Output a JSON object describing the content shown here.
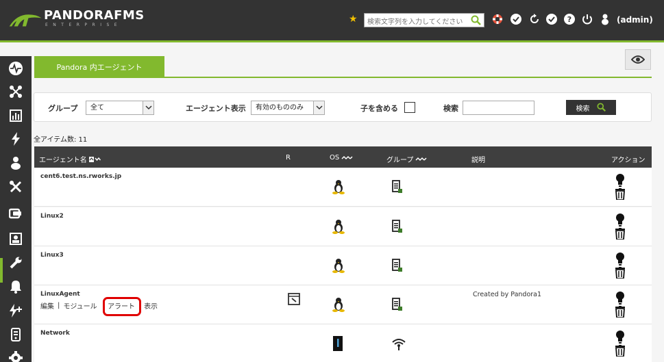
{
  "header": {
    "logo_text": "PANDORAFMS",
    "logo_sub": "ENTERPRISE",
    "search_placeholder": "検索文字列を入力してください",
    "user": "(admin)"
  },
  "colors": {
    "accent": "#82b92e",
    "header_bg": "#333333",
    "highlight": "#e00000"
  },
  "sidebar": {
    "items": [
      "monitoring-icon",
      "topology-icon",
      "reports-icon",
      "events-icon",
      "users-icon",
      "tools-icon",
      "agents-icon",
      "contacts-icon",
      "settings-icon",
      "alerts-icon",
      "extensions-icon",
      "server-icon",
      "gear-icon"
    ]
  },
  "tab": {
    "label": "Pandora 内エージェント"
  },
  "filter": {
    "group_label": "グループ",
    "group_value": "全て",
    "show_label": "エージェント表示",
    "show_value": "有効のもののみ",
    "children_label": "子を含める",
    "search_label": "検索",
    "search_button": "検索"
  },
  "total": "全アイテム数: 11",
  "table": {
    "columns": {
      "name": "エージェント名",
      "r": "R",
      "os": "OS",
      "group": "グループ",
      "desc": "説明",
      "actions": "アクション"
    },
    "rows": [
      {
        "name": "cent6.test.ns.rworks.jp",
        "os": "linux",
        "group": "servers",
        "desc": ""
      },
      {
        "name": "Linux2",
        "os": "linux",
        "group": "servers",
        "desc": ""
      },
      {
        "name": "Linux3",
        "os": "linux",
        "group": "servers",
        "desc": ""
      },
      {
        "name": "LinuxAgent",
        "os": "linux",
        "group": "servers",
        "desc": "Created by Pandora1",
        "actions": {
          "edit": "編集",
          "sep1": "|",
          "modules": "モジュール",
          "sep2": "|",
          "alerts": "アラート",
          "view": "表示"
        }
      },
      {
        "name": "Network",
        "os": "network",
        "group": "network",
        "desc": ""
      }
    ]
  }
}
